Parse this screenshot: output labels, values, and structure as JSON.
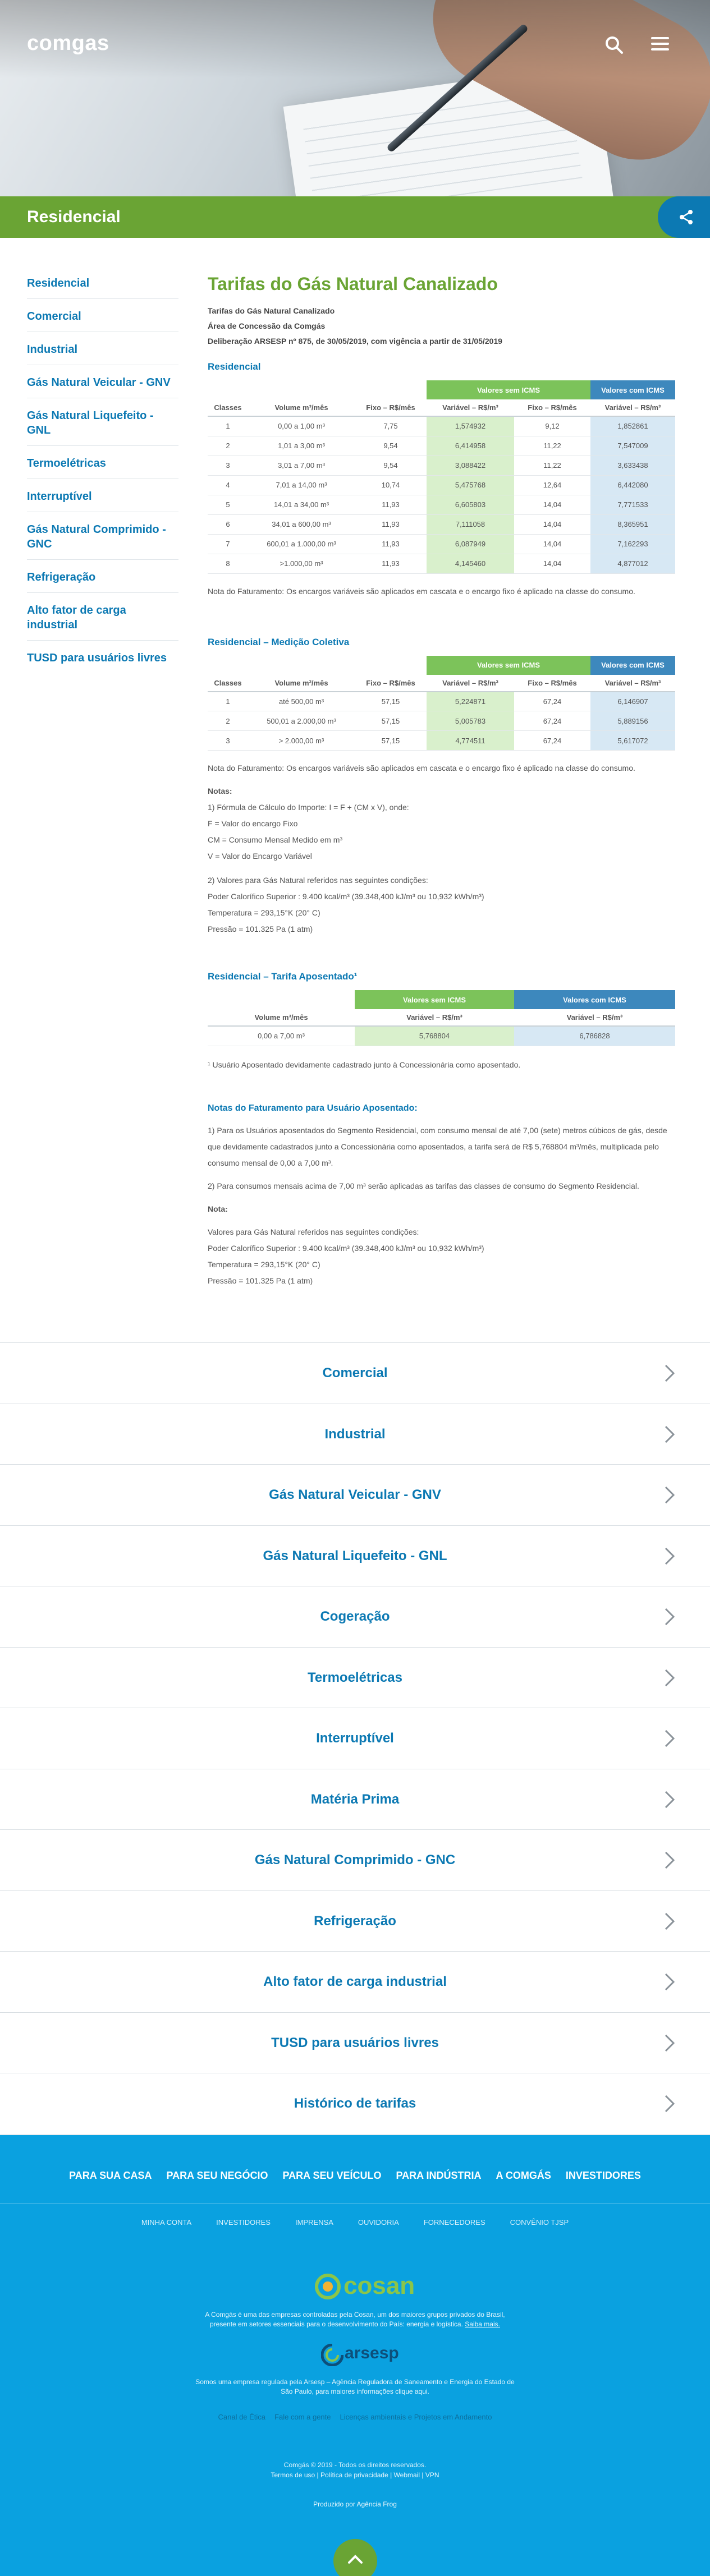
{
  "header": {
    "logo": "comgas"
  },
  "banner": {
    "title": "Residencial"
  },
  "sidebar": {
    "items": [
      {
        "label": "Residencial"
      },
      {
        "label": "Comercial"
      },
      {
        "label": "Industrial"
      },
      {
        "label": "Gás Natural Veicular - GNV"
      },
      {
        "label": "Gás Natural Liquefeito - GNL"
      },
      {
        "label": "Termoelétricas"
      },
      {
        "label": "Interruptível"
      },
      {
        "label": "Gás Natural Comprimido - GNC"
      },
      {
        "label": "Refrigeração"
      },
      {
        "label": "Alto fator de carga industrial"
      },
      {
        "label": "TUSD para usuários livres"
      }
    ]
  },
  "content": {
    "title": "Tarifas do Gás Natural Canalizado",
    "meta1": "Tarifas do Gás Natural Canalizado",
    "meta2": "Área de Concessão da Comgás",
    "meta3": "Deliberação ARSESP nº 875, de 30/05/2019, com vigência a partir de 31/05/2019",
    "table1": {
      "title": "Residencial",
      "group_no_icms": "Valores sem ICMS",
      "group_icms": "Valores com ICMS",
      "headers": [
        "Classes",
        "Volume m³/mês",
        "Fixo – R$/mês",
        "Variável – R$/m³",
        "Fixo – R$/mês",
        "Variável – R$/m³"
      ],
      "rows": [
        [
          "1",
          "0,00 a 1,00 m³",
          "7,75",
          "1,574932",
          "9,12",
          "1,852861"
        ],
        [
          "2",
          "1,01 a 3,00 m³",
          "9,54",
          "6,414958",
          "11,22",
          "7,547009"
        ],
        [
          "3",
          "3,01 a 7,00 m³",
          "9,54",
          "3,088422",
          "11,22",
          "3,633438"
        ],
        [
          "4",
          "7,01 a 14,00 m³",
          "10,74",
          "5,475768",
          "12,64",
          "6,442080"
        ],
        [
          "5",
          "14,01 a 34,00 m³",
          "11,93",
          "6,605803",
          "14,04",
          "7,771533"
        ],
        [
          "6",
          "34,01 a 600,00 m³",
          "11,93",
          "7,111058",
          "14,04",
          "8,365951"
        ],
        [
          "7",
          "600,01 a 1.000,00 m³",
          "11,93",
          "6,087949",
          "14,04",
          "7,162293"
        ],
        [
          "8",
          ">1.000,00 m³",
          "11,93",
          "4,145460",
          "14,04",
          "4,877012"
        ]
      ],
      "note": "Nota do Faturamento: Os encargos variáveis são aplicados em cascata e o encargo fixo é aplicado na classe do consumo."
    },
    "table2": {
      "title": "Residencial – Medição Coletiva",
      "group_no_icms": "Valores sem ICMS",
      "group_icms": "Valores com ICMS",
      "headers": [
        "Classes",
        "Volume m³/mês",
        "Fixo – R$/mês",
        "Variável – R$/m³",
        "Fixo – R$/mês",
        "Variável – R$/m³"
      ],
      "rows": [
        [
          "1",
          "até 500,00 m³",
          "57,15",
          "5,224871",
          "67,24",
          "6,146907"
        ],
        [
          "2",
          "500,01 a 2.000,00 m³",
          "57,15",
          "5,005783",
          "67,24",
          "5,889156"
        ],
        [
          "3",
          "> 2.000,00 m³",
          "57,15",
          "4,774511",
          "67,24",
          "5,617072"
        ]
      ],
      "note": "Nota do Faturamento: Os encargos variáveis são aplicados em cascata e o encargo fixo é aplicado na classe do consumo."
    },
    "notes": {
      "heading": "Notas:",
      "lines": [
        "1) Fórmula de Cálculo do Importe: I = F + (CM x V), onde:",
        "F = Valor do encargo Fixo",
        "CM = Consumo Mensal Medido em m³",
        "V = Valor do Encargo Variável",
        "",
        "2) Valores para Gás Natural referidos nas seguintes condições:",
        "Poder Calorífico Superior : 9.400 kcal/m³ (39.348,400 kJ/m³ ou 10,932 kWh/m³)",
        "Temperatura = 293,15°K (20° C)",
        "Pressão = 101.325 Pa (1 atm)"
      ]
    },
    "table3": {
      "title": "Residencial – Tarifa Aposentado¹",
      "group_no_icms": "Valores sem ICMS",
      "group_icms": "Valores com ICMS",
      "headers": [
        "Volume m³/mês",
        "Variável – R$/m³",
        "Variável – R$/m³"
      ],
      "rows": [
        [
          "0,00 a 7,00 m³",
          "5,768804",
          "6,786828"
        ]
      ],
      "note": "¹ Usuário Aposentado devidamente cadastrado junto à Concessionária como aposentado."
    },
    "retiree": {
      "heading": "Notas do Faturamento para Usuário Aposentado:",
      "p1": "1) Para os Usuários aposentados do Segmento Residencial, com consumo mensal de até 7,00 (sete) metros cúbicos de gás, desde que devidamente cadastrados junto a Concessionária como aposentados, a tarifa será de R$ 5,768804 m³/mês, multiplicada pelo consumo mensal de 0,00 a 7,00 m³.",
      "p2": "2) Para consumos mensais acima de 7,00 m³ serão aplicadas as tarifas das classes de consumo do Segmento Residencial.",
      "note_heading": "Nota:",
      "lines": [
        "Valores para Gás Natural referidos nas seguintes condições:",
        "Poder Calorífico Superior : 9.400 kcal/m³ (39.348,400 kJ/m³ ou 10,932 kWh/m³)",
        "Temperatura = 293,15°K (20° C)",
        "Pressão = 101.325 Pa (1 atm)"
      ]
    }
  },
  "accordion": {
    "items": [
      {
        "label": "Comercial"
      },
      {
        "label": "Industrial"
      },
      {
        "label": "Gás Natural Veicular - GNV"
      },
      {
        "label": "Gás Natural Liquefeito - GNL"
      },
      {
        "label": "Cogeração"
      },
      {
        "label": "Termoelétricas"
      },
      {
        "label": "Interruptível"
      },
      {
        "label": "Matéria Prima"
      },
      {
        "label": "Gás Natural Comprimido - GNC"
      },
      {
        "label": "Refrigeração"
      },
      {
        "label": "Alto fator de carga industrial"
      },
      {
        "label": "TUSD para usuários livres"
      },
      {
        "label": "Histórico de tarifas"
      }
    ]
  },
  "footer": {
    "main_links": [
      "PARA SUA CASA",
      "PARA SEU NEGÓCIO",
      "PARA SEU VEÍCULO",
      "PARA INDÚSTRIA",
      "A COMGÁS",
      "INVESTIDORES"
    ],
    "sub_links": [
      "MINHA CONTA",
      "INVESTIDORES",
      "IMPRENSA",
      "OUVIDORIA",
      "FORNECEDORES",
      "CONVÊNIO TJSP"
    ],
    "cosan_logo": "cosan",
    "cosan_text_1": "A Comgás é uma das empresas controladas pela Cosan, um dos maiores grupos privados do Brasil,",
    "cosan_text_2": "presente em setores essenciais para o desenvolvimento do País: energia e logística.",
    "cosan_link": "Saiba mais.",
    "arsesp_logo": "arsesp",
    "arsesp_text_1": "Somos uma empresa regulada pela Arsesp – Agência Reguladora de Saneamento e Energia do Estado de",
    "arsesp_text_2": "São Paulo, para maiores informações clique aqui.",
    "extra_links": [
      "Canal de Ética",
      "Fale com a gente",
      "Licenças ambientais e Projetos em Andamento"
    ],
    "copyright": "Comgás © 2019 - Todos os direitos reservados.",
    "legal_links": [
      "Termos de uso",
      "Política de privacidade",
      "Webmail",
      "VPN"
    ],
    "credit": "Produzido por Agência Frog"
  },
  "colors": {
    "green": "#6aa434",
    "blue": "#0c79b3",
    "footer_blue": "#0aa1e0"
  }
}
